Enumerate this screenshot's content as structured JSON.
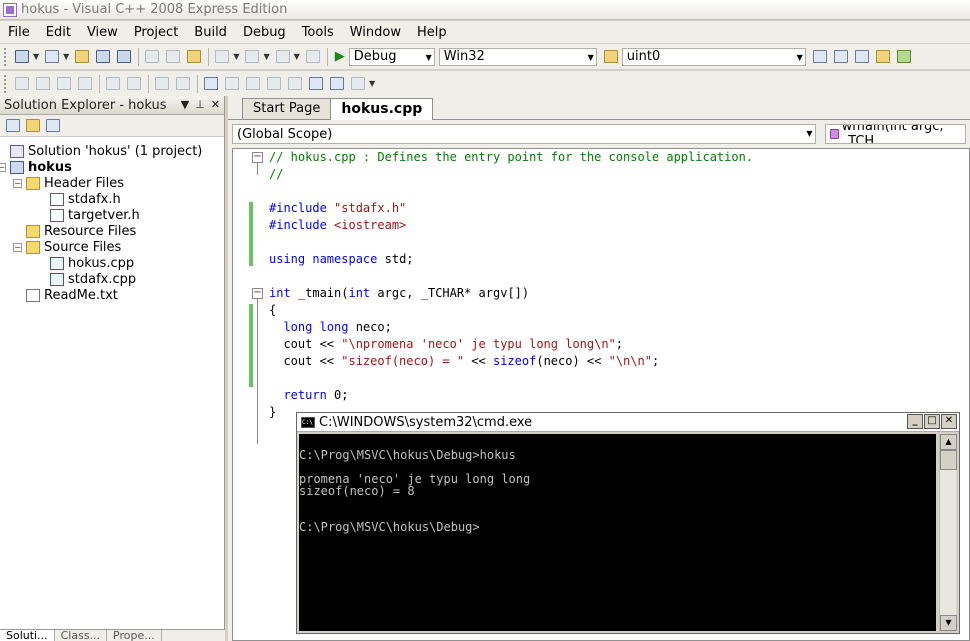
{
  "window": {
    "title": "hokus - Visual C++ 2008 Express Edition"
  },
  "menu": [
    "File",
    "Edit",
    "View",
    "Project",
    "Build",
    "Debug",
    "Tools",
    "Window",
    "Help"
  ],
  "toolbar": {
    "config": "Debug",
    "platform": "Win32",
    "find_value": "uint0"
  },
  "solution_explorer": {
    "title": "Solution Explorer - hokus",
    "tree": [
      {
        "label": "Solution 'hokus' (1 project)",
        "icon": "solution-icon",
        "level": 0,
        "bold": false
      },
      {
        "label": "hokus",
        "icon": "project-icon",
        "level": 0,
        "bold": true,
        "expander": "−"
      },
      {
        "label": "Header Files",
        "icon": "folder-icon",
        "level": 1,
        "expander": "−"
      },
      {
        "label": "stdafx.h",
        "icon": "header-file-icon",
        "level": 2
      },
      {
        "label": "targetver.h",
        "icon": "header-file-icon",
        "level": 2
      },
      {
        "label": "Resource Files",
        "icon": "folder-icon",
        "level": 1
      },
      {
        "label": "Source Files",
        "icon": "folder-icon",
        "level": 1,
        "expander": "−"
      },
      {
        "label": "hokus.cpp",
        "icon": "cpp-file-icon",
        "level": 2
      },
      {
        "label": "stdafx.cpp",
        "icon": "cpp-file-icon",
        "level": 2
      },
      {
        "label": "ReadMe.txt",
        "icon": "text-file-icon",
        "level": 1
      }
    ],
    "bottom_tabs": [
      "Soluti...",
      "Class...",
      "Prope..."
    ]
  },
  "doc_tabs": [
    {
      "label": "Start Page",
      "active": false
    },
    {
      "label": "hokus.cpp",
      "active": true
    }
  ],
  "nav": {
    "scope": "(Global Scope)",
    "member": "wmain(int argc, _TCH"
  },
  "code_lines": [
    [
      {
        "t": "// hokus.cpp : Defines the entry point for the console application.",
        "c": "cm"
      }
    ],
    [
      {
        "t": "//",
        "c": "cm"
      }
    ],
    [],
    [
      {
        "t": "#include ",
        "c": "pp"
      },
      {
        "t": "\"stdafx.h\"",
        "c": "st"
      }
    ],
    [
      {
        "t": "#include ",
        "c": "pp"
      },
      {
        "t": "<iostream>",
        "c": "st"
      }
    ],
    [],
    [
      {
        "t": "using",
        "c": "kw"
      },
      {
        "t": " "
      },
      {
        "t": "namespace",
        "c": "kw"
      },
      {
        "t": " std;"
      }
    ],
    [],
    [
      {
        "t": "int",
        "c": "kw"
      },
      {
        "t": " _tmain("
      },
      {
        "t": "int",
        "c": "kw"
      },
      {
        "t": " argc, _TCHAR* argv[])"
      }
    ],
    [
      {
        "t": "{"
      }
    ],
    [
      {
        "t": "  "
      },
      {
        "t": "long",
        "c": "kw"
      },
      {
        "t": " "
      },
      {
        "t": "long",
        "c": "kw"
      },
      {
        "t": " neco;"
      }
    ],
    [
      {
        "t": "  cout << "
      },
      {
        "t": "\"\\npromena 'neco' je typu long long\\n\"",
        "c": "st"
      },
      {
        "t": ";"
      }
    ],
    [
      {
        "t": "  cout << "
      },
      {
        "t": "\"sizeof(neco) = \"",
        "c": "st"
      },
      {
        "t": " << "
      },
      {
        "t": "sizeof",
        "c": "kw"
      },
      {
        "t": "(neco) << "
      },
      {
        "t": "\"\\n\\n\"",
        "c": "st"
      },
      {
        "t": ";"
      }
    ],
    [],
    [
      {
        "t": "  "
      },
      {
        "t": "return",
        "c": "kw"
      },
      {
        "t": " 0;"
      }
    ],
    [
      {
        "t": "}"
      }
    ]
  ],
  "console": {
    "title": "C:\\WINDOWS\\system32\\cmd.exe",
    "lines": [
      "C:\\Prog\\MSVC\\hokus\\Debug>hokus",
      "",
      "promena 'neco' je typu long long",
      "sizeof(neco) = 8",
      "",
      "",
      "C:\\Prog\\MSVC\\hokus\\Debug>"
    ]
  }
}
